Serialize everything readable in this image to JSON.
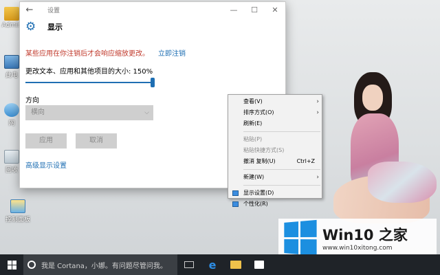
{
  "desktop": {
    "icons": [
      {
        "label": "Admin"
      },
      {
        "label": "此电"
      },
      {
        "label": "网"
      },
      {
        "label": "回收"
      },
      {
        "label": "控制面板"
      }
    ]
  },
  "settings_window": {
    "titlebar_title": "设置",
    "back_glyph": "←",
    "minimize_glyph": "—",
    "maximize_glyph": "☐",
    "close_glyph": "✕",
    "header_title": "显示",
    "warning_text": "某些应用在你注销后才会响应缩放更改。",
    "signout_link": "立即注销",
    "scale_label": "更改文本、应用和其他项目的大小: 150%",
    "scale_value": 1.0,
    "orientation_label": "方向",
    "orientation_value": "横向",
    "apply_label": "应用",
    "cancel_label": "取消",
    "advanced_link": "高级显示设置",
    "accent": "#1f6fb3",
    "warning_color": "#c0392b"
  },
  "context_menu": {
    "items": [
      {
        "label": "查看(V)",
        "submenu": true,
        "disabled": false
      },
      {
        "label": "排序方式(O)",
        "submenu": true,
        "disabled": false
      },
      {
        "label": "刷新(E)",
        "submenu": false,
        "disabled": false
      },
      {
        "label": "粘贴(P)",
        "submenu": false,
        "disabled": true
      },
      {
        "label": "粘贴快捷方式(S)",
        "submenu": false,
        "disabled": true
      },
      {
        "label": "撤消 复制(U)",
        "shortcut": "Ctrl+Z",
        "submenu": false,
        "disabled": false
      },
      {
        "label": "新建(W)",
        "submenu": true,
        "disabled": false
      },
      {
        "label": "显示设置(D)",
        "icon": "display-icon",
        "submenu": false,
        "disabled": false
      },
      {
        "label": "个性化(R)",
        "icon": "personalize-icon",
        "submenu": false,
        "disabled": false
      }
    ]
  },
  "watermark": {
    "brand": "Win10 之家",
    "site": "www.win10xitong.com"
  },
  "taskbar": {
    "search_placeholder": "我是 Cortana，小娜。有问题尽管问我。",
    "icons": [
      "task-view-icon",
      "edge-icon",
      "file-explorer-icon",
      "store-icon"
    ]
  }
}
